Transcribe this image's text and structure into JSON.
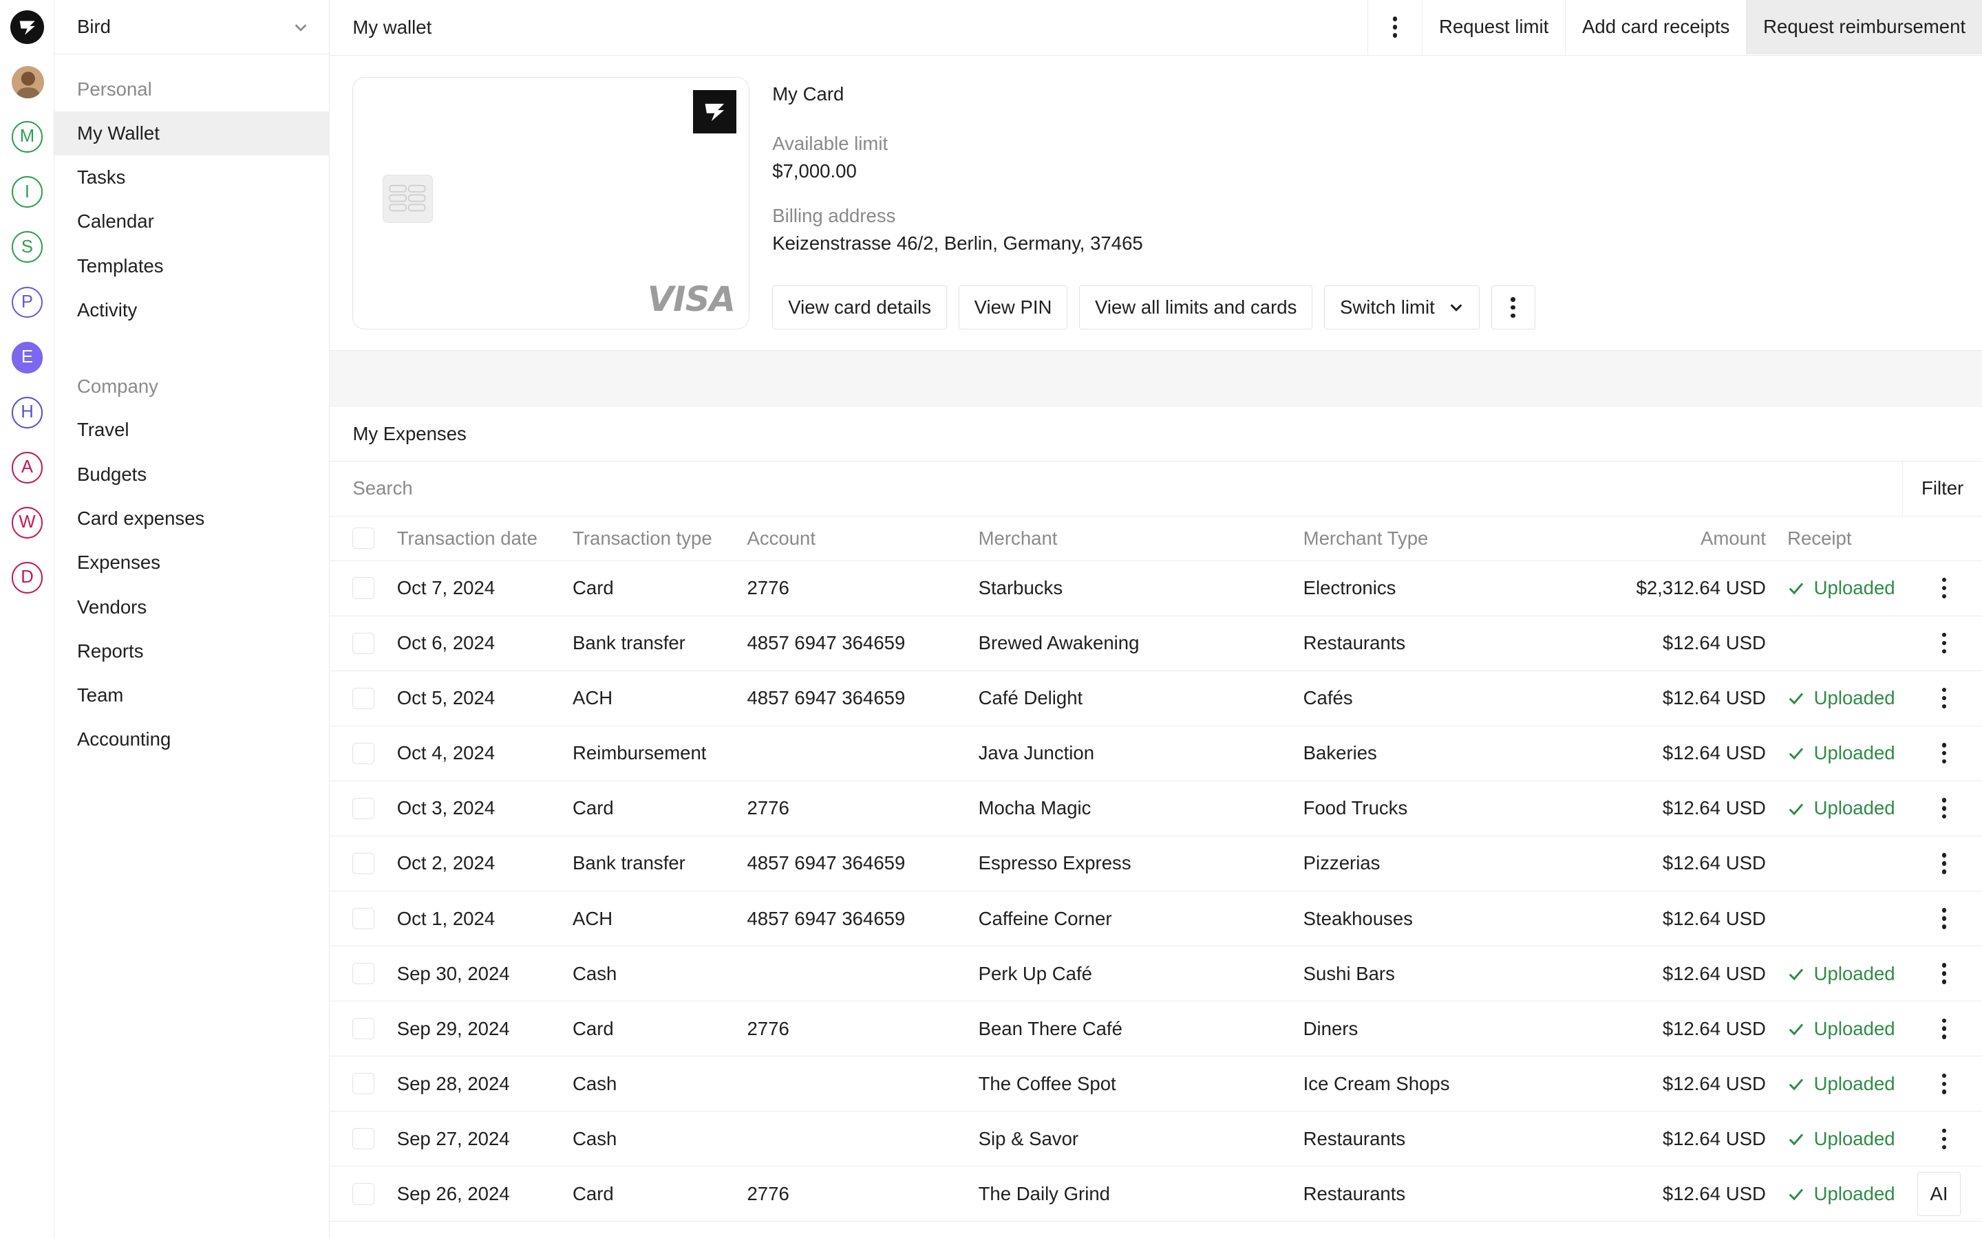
{
  "rail": {
    "items": [
      {
        "letter": "M",
        "color": "#2e9e4f",
        "filled": false
      },
      {
        "letter": "I",
        "color": "#2e9e4f",
        "filled": false
      },
      {
        "letter": "S",
        "color": "#2e9e4f",
        "filled": false
      },
      {
        "letter": "P",
        "color": "#6b5bd6",
        "filled": false
      },
      {
        "letter": "E",
        "color": "#7b68ee",
        "filled": true
      },
      {
        "letter": "H",
        "color": "#5a4fcf",
        "filled": false
      },
      {
        "letter": "A",
        "color": "#c2185b",
        "filled": false
      },
      {
        "letter": "W",
        "color": "#c2185b",
        "filled": false
      },
      {
        "letter": "D",
        "color": "#c2185b",
        "filled": false
      }
    ]
  },
  "sidebar": {
    "org_name": "Bird",
    "personal_label": "Personal",
    "personal_items": [
      "My Wallet",
      "Tasks",
      "Calendar",
      "Templates",
      "Activity"
    ],
    "company_label": "Company",
    "company_items": [
      "Travel",
      "Budgets",
      "Card expenses",
      "Expenses",
      "Vendors",
      "Reports",
      "Team",
      "Accounting"
    ],
    "active_item": "My Wallet"
  },
  "topbar": {
    "title": "My wallet",
    "request_limit": "Request limit",
    "add_card_receipts": "Add card receipts",
    "request_reimbursement": "Request reimbursement"
  },
  "card": {
    "network": "VISA",
    "title": "My Card",
    "available_limit_label": "Available limit",
    "available_limit_value": "$7,000.00",
    "billing_address_label": "Billing address",
    "billing_address_value": "Keizenstrasse 46/2, Berlin, Germany, 37465",
    "actions": {
      "view_card_details": "View card details",
      "view_pin": "View PIN",
      "view_all_limits": "View all limits and cards",
      "switch_limit": "Switch limit"
    }
  },
  "expenses": {
    "title": "My Expenses",
    "search_placeholder": "Search",
    "filter_label": "Filter",
    "columns": {
      "date": "Transaction date",
      "type": "Transaction type",
      "account": "Account",
      "merchant": "Merchant",
      "merchant_type": "Merchant Type",
      "amount": "Amount",
      "receipt": "Receipt"
    },
    "rows": [
      {
        "date": "Oct 7, 2024",
        "type": "Card",
        "account": "2776",
        "merchant": "Starbucks",
        "merchant_type": "Electronics",
        "amount": "$2,312.64 USD",
        "receipt": "Uploaded"
      },
      {
        "date": "Oct 6, 2024",
        "type": "Bank transfer",
        "account": "4857 6947 364659",
        "merchant": "Brewed Awakening",
        "merchant_type": "Restaurants",
        "amount": "$12.64 USD",
        "receipt": ""
      },
      {
        "date": "Oct 5, 2024",
        "type": "ACH",
        "account": "4857 6947 364659",
        "merchant": "Café Delight",
        "merchant_type": "Cafés",
        "amount": "$12.64 USD",
        "receipt": "Uploaded"
      },
      {
        "date": "Oct 4, 2024",
        "type": "Reimbursement",
        "account": "",
        "merchant": "Java Junction",
        "merchant_type": "Bakeries",
        "amount": "$12.64 USD",
        "receipt": "Uploaded"
      },
      {
        "date": "Oct 3, 2024",
        "type": "Card",
        "account": "2776",
        "merchant": "Mocha Magic",
        "merchant_type": "Food Trucks",
        "amount": "$12.64 USD",
        "receipt": "Uploaded"
      },
      {
        "date": "Oct 2, 2024",
        "type": "Bank transfer",
        "account": "4857 6947 364659",
        "merchant": "Espresso Express",
        "merchant_type": "Pizzerias",
        "amount": "$12.64 USD",
        "receipt": ""
      },
      {
        "date": "Oct 1, 2024",
        "type": "ACH",
        "account": "4857 6947 364659",
        "merchant": "Caffeine Corner",
        "merchant_type": "Steakhouses",
        "amount": "$12.64 USD",
        "receipt": ""
      },
      {
        "date": "Sep 30, 2024",
        "type": "Cash",
        "account": "",
        "merchant": "Perk Up Café",
        "merchant_type": "Sushi Bars",
        "amount": "$12.64 USD",
        "receipt": "Uploaded"
      },
      {
        "date": "Sep 29, 2024",
        "type": "Card",
        "account": "2776",
        "merchant": "Bean There Café",
        "merchant_type": "Diners",
        "amount": "$12.64 USD",
        "receipt": "Uploaded"
      },
      {
        "date": "Sep 28, 2024",
        "type": "Cash",
        "account": "",
        "merchant": "The Coffee Spot",
        "merchant_type": "Ice Cream Shops",
        "amount": "$12.64 USD",
        "receipt": "Uploaded"
      },
      {
        "date": "Sep 27, 2024",
        "type": "Cash",
        "account": "",
        "merchant": "Sip & Savor",
        "merchant_type": "Restaurants",
        "amount": "$12.64 USD",
        "receipt": "Uploaded"
      },
      {
        "date": "Sep 26, 2024",
        "type": "Card",
        "account": "2776",
        "merchant": "The Daily Grind",
        "merchant_type": "Restaurants",
        "amount": "$12.64 USD",
        "receipt": "Uploaded"
      }
    ],
    "ai_badge": "AI"
  }
}
